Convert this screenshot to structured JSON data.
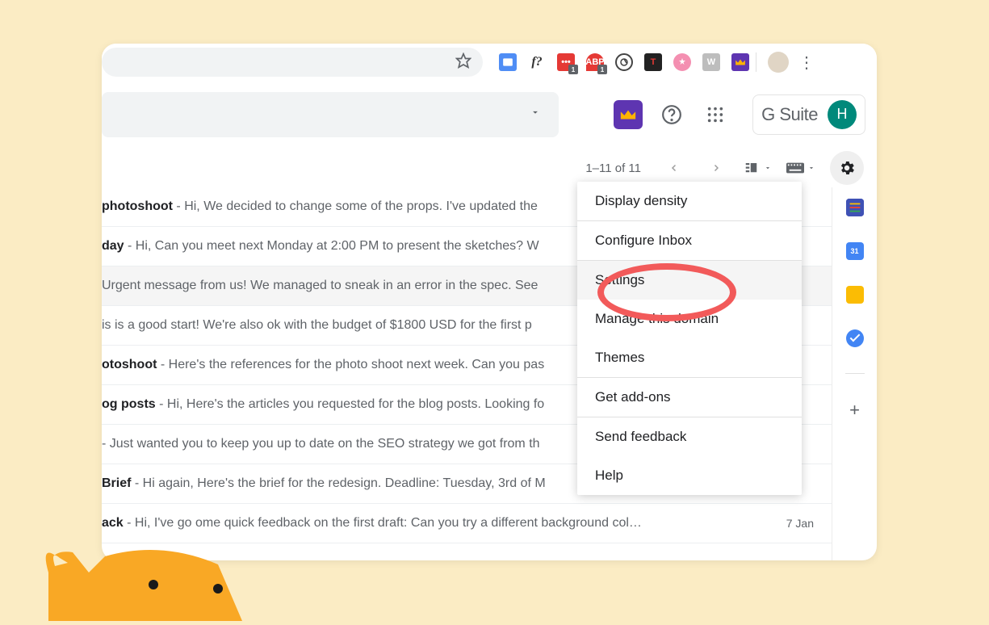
{
  "chrome": {
    "extensions": {
      "badge1": "1",
      "badge2": "1",
      "font_label": "f?",
      "w_label": "W"
    }
  },
  "header": {
    "gsuite_label": "G Suite",
    "avatar_letter": "H"
  },
  "toolbar": {
    "page_count": "1–11 of 11"
  },
  "sidepanel": {
    "calendar_day": "31"
  },
  "emails": [
    {
      "subject": "photoshoot",
      "snippet": " - Hi, We decided to change some of the props. I've updated the",
      "highlight": false,
      "date": ""
    },
    {
      "subject": "day",
      "snippet": " - Hi, Can you meet next Monday at 2:00 PM to present the sketches? W",
      "highlight": false,
      "date": ""
    },
    {
      "subject": "",
      "snippet": "Urgent message from us! We managed to sneak in an error in the spec. See ",
      "highlight": true,
      "date": ""
    },
    {
      "subject": "",
      "snippet": "is is a good start! We're also ok with the budget of $1800 USD for the first p",
      "highlight": false,
      "date": ""
    },
    {
      "subject": "otoshoot",
      "snippet": " - Here's the references for the photo shoot next week. Can you pas",
      "highlight": false,
      "date": ""
    },
    {
      "subject": "og posts",
      "snippet": " - Hi, Here's the articles you requested for the blog posts. Looking fo",
      "highlight": false,
      "date": ""
    },
    {
      "subject": "",
      "snippet": "- Just wanted you to keep you up to date on the SEO strategy we got from th",
      "highlight": false,
      "date": ""
    },
    {
      "subject": "Brief",
      "snippet": " - Hi again, Here's the brief for the redesign. Deadline: Tuesday, 3rd of M",
      "highlight": false,
      "date": ""
    },
    {
      "subject": "ack",
      "snippet": " - Hi, I've go  ome quick feedback on the first draft: Can you try a different background col…",
      "highlight": false,
      "date": "7 Jan"
    }
  ],
  "settings_menu": [
    {
      "label": "Display density",
      "divider_after": true,
      "hover": false
    },
    {
      "label": "Configure Inbox",
      "divider_after": true,
      "hover": false
    },
    {
      "label": "Settings",
      "divider_after": false,
      "hover": true
    },
    {
      "label": "Manage this domain",
      "divider_after": false,
      "hover": false
    },
    {
      "label": "Themes",
      "divider_after": true,
      "hover": false
    },
    {
      "label": "Get add-ons",
      "divider_after": true,
      "hover": false
    },
    {
      "label": "Send feedback",
      "divider_after": false,
      "hover": false
    },
    {
      "label": "Help",
      "divider_after": false,
      "hover": false
    }
  ]
}
